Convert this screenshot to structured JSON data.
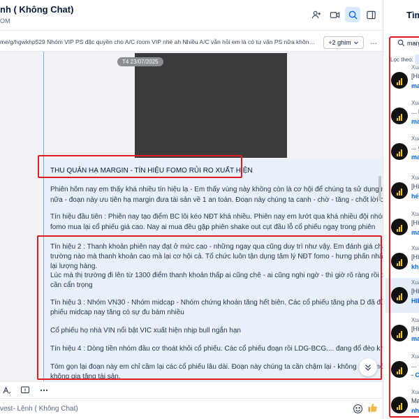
{
  "header": {
    "title": "nh ( Không Chat)",
    "subtitle": "OM"
  },
  "pinned": {
    "text": "me/g/hgwkhp529 Nhóm VIP PS đặc quyền cho A/C room VIP nhé ah Nhiều A/C vẫn hỏi em là có tư vấn PS nữa không? em gửi đ...",
    "pin_count_label": "+2 ghim",
    "more_label": "..."
  },
  "chat": {
    "date": "T4 23/07/2025",
    "message_lines": [
      "THU QUẢN HẠ MARGIN - TÍN HIỆU FOMO RỦI RO XUẤT HIỆN",
      "Phiên hôm nay em thấy khá nhiều tín hiệu lạ - Em thấy vùng này không còn là cơ hội để chúng ta sử dụng margin",
      "nữa - đoạn này ưu tiên hạ margin đưa tài sản về 1 an toàn. Đoạn này chúng ta canh - chờ - tăng - chốt lời cổ phiếu.",
      "Tín hiệu đầu tiên : Phiên nay tạo điểm BC lôi kéo NĐT khá nhiều. Phiên nay em lướt qua khá nhiều đội nhóm đang",
      "fomo mua lại cổ phiếu giá cao. Nay ai mua đều gặp phiên shake out cụt đầu lỗ cổ phiếu ngay trong phiên",
      "Tín hiệu 2 : Thanh khoản phiên nay đạt ở mức cao - những ngay qua cũng duy trì như vậy. Em đánh giá chả có thị",
      "trường nào mà thanh khoản cao mà lại cơ hội cả. Tổ chức luôn tận dụng tâm lý NĐT fomo - hưng phấn nhất để trao",
      "lại lượng hàng.",
      "Lúc mà thị trường đi lên từ 1300 điểm thanh khoản thấp ai cũng chê - ai cũng nghi ngờ - thì giờ rõ ràng rồi chúng ta",
      "cần cẩn trọng",
      "Tín hiệu 3 : Nhóm VN30 - Nhóm midcap - Nhóm chứng khoán tăng hết biên. Các cổ phiếu tăng pha D đã đủ hay cổ",
      "phiếu midcap nay tăng có sự đu bám nhiều",
      "Cổ phiếu họ nhà VIN nổi bật VIC xuất hiện nhịp bull ngắn hạn",
      "Tín hiệu 4 : Dòng tiền nhóm đầu cơ thoát khỏi cổ phiếu. Các cổ phiếu đoạn rồi LDG-BCG.... đang đổ đèo khá mạnh",
      "Tóm gọn lại đoạn này em chỉ cầm lại các cổ phiếu lâu dài. Đoạn này chúng ta cần chậm lại - không mua mới -",
      "không gia tăng tài sản."
    ]
  },
  "input": {
    "placeholder": "vest- Lệnh ( Không Chat)"
  },
  "right_panel": {
    "title": "Tìm",
    "search_value": "marg",
    "filter_label": "Lọc theo:",
    "results": [
      {
        "name": "Xuâ",
        "line1": "[Hì",
        "line2": "ma"
      },
      {
        "name": "Xuâ",
        "line1": "... b",
        "line2": "ma"
      },
      {
        "name": "Xuâ",
        "line1": "... g",
        "line2": "ma"
      },
      {
        "name": "Xuâ",
        "line1": "[Hì",
        "line2": "hết"
      },
      {
        "name": "Xuâ",
        "line1": "[Hì",
        "line2": "ma"
      },
      {
        "name": "Xuâ",
        "line1": "[Hì",
        "line2": "kho"
      },
      {
        "name": "Xuâ",
        "line1": "[Hì",
        "line2": "HIỆ"
      },
      {
        "name": "Xuâ",
        "line1": "[Hì",
        "line2": "ma"
      },
      {
        "name": "Xuâ",
        "line1": "... ",
        "line2": "- Cá"
      },
      {
        "name": "Xuâ",
        "line1": "Ma",
        "line2": "nhé"
      }
    ]
  }
}
